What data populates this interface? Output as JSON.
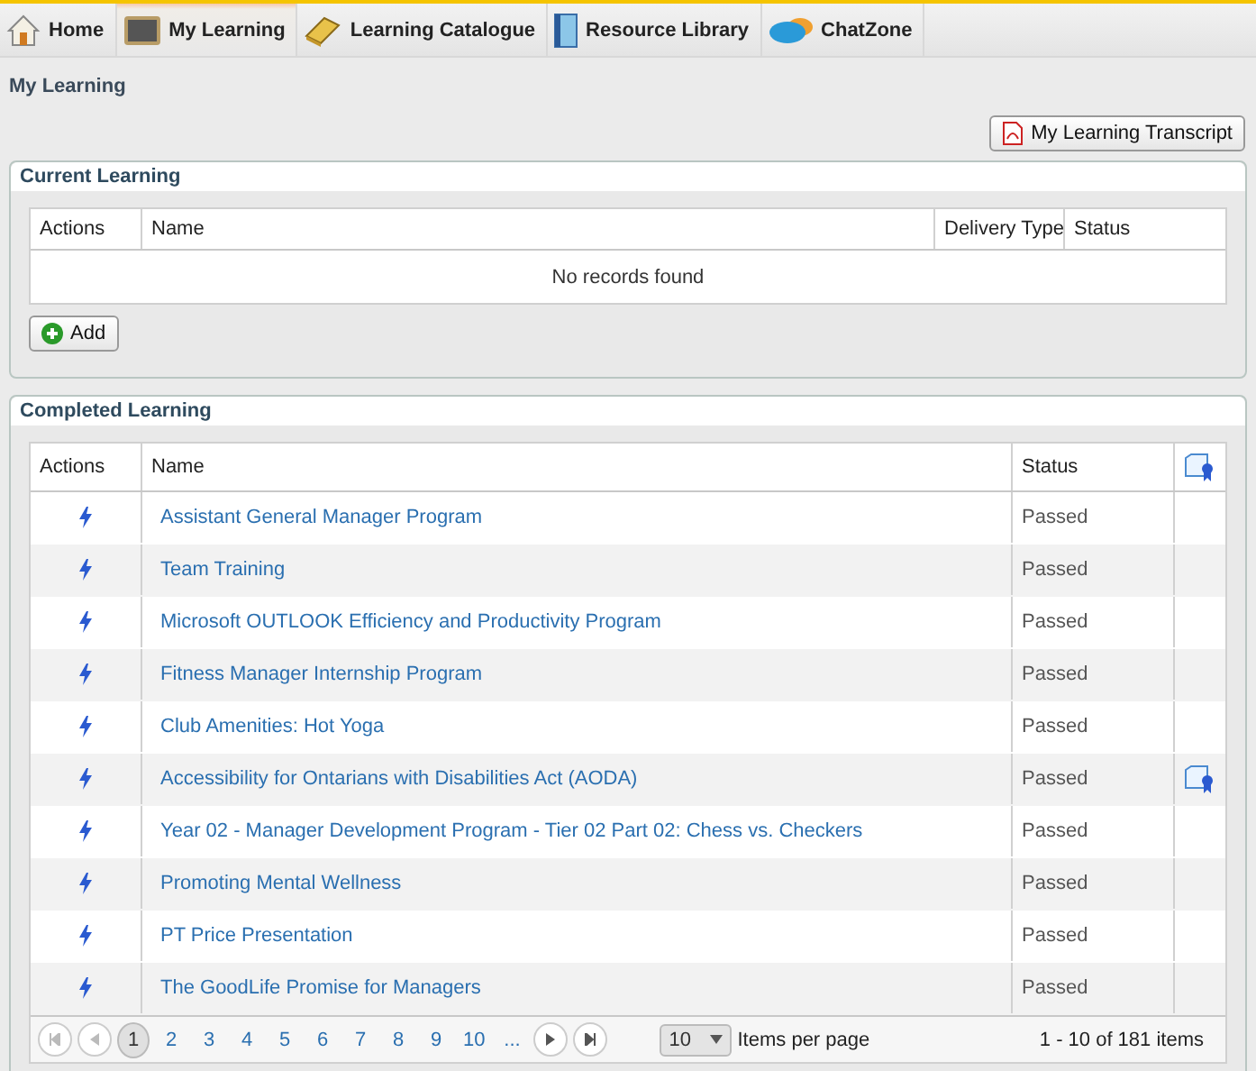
{
  "nav": [
    {
      "label": "Home",
      "selected": false
    },
    {
      "label": "My Learning",
      "selected": true
    },
    {
      "label": "Learning Catalogue",
      "selected": false
    },
    {
      "label": "Resource Library",
      "selected": false
    },
    {
      "label": "ChatZone",
      "selected": false
    }
  ],
  "page_title": "My Learning",
  "transcript_button": "My Learning Transcript",
  "current_learning": {
    "title": "Current Learning",
    "columns": [
      "Actions",
      "Name",
      "Delivery Type",
      "Status"
    ],
    "empty_message": "No records found",
    "add_button": "Add"
  },
  "completed_learning": {
    "title": "Completed Learning",
    "columns": [
      "Actions",
      "Name",
      "Status"
    ],
    "rows": [
      {
        "name": "Assistant General Manager Program",
        "status": "Passed",
        "certificate": false
      },
      {
        "name": "Team Training",
        "status": "Passed",
        "certificate": false
      },
      {
        "name": "Microsoft OUTLOOK Efficiency and Productivity Program",
        "status": "Passed",
        "certificate": false
      },
      {
        "name": "Fitness Manager Internship Program",
        "status": "Passed",
        "certificate": false
      },
      {
        "name": "Club Amenities: Hot Yoga",
        "status": "Passed",
        "certificate": false
      },
      {
        "name": "Accessibility for Ontarians with Disabilities Act (AODA)",
        "status": "Passed",
        "certificate": true
      },
      {
        "name": "Year 02 - Manager Development Program - Tier 02 Part 02: Chess vs. Checkers",
        "status": "Passed",
        "certificate": false
      },
      {
        "name": "Promoting Mental Wellness",
        "status": "Passed",
        "certificate": false
      },
      {
        "name": "PT Price Presentation",
        "status": "Passed",
        "certificate": false
      },
      {
        "name": "The GoodLife Promise for Managers",
        "status": "Passed",
        "certificate": false
      }
    ],
    "pager": {
      "pages": [
        {
          "label": "1",
          "selected": true
        },
        {
          "label": "2",
          "selected": false
        },
        {
          "label": "3",
          "selected": false
        },
        {
          "label": "4",
          "selected": false
        },
        {
          "label": "5",
          "selected": false
        },
        {
          "label": "6",
          "selected": false
        },
        {
          "label": "7",
          "selected": false
        },
        {
          "label": "8",
          "selected": false
        },
        {
          "label": "9",
          "selected": false
        },
        {
          "label": "10",
          "selected": false
        },
        {
          "label": "...",
          "selected": false
        }
      ],
      "page_size": "10",
      "page_size_label": "Items per page",
      "summary": "1 - 10 of 181 items"
    }
  }
}
